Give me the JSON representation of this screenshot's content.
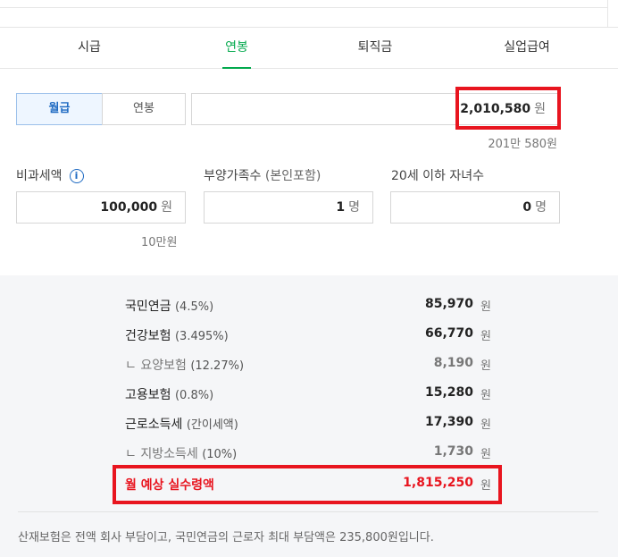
{
  "tabs": [
    {
      "label": "시급"
    },
    {
      "label": "연봉"
    },
    {
      "label": "퇴직금"
    },
    {
      "label": "실업급여"
    }
  ],
  "pay_type": {
    "monthly": "월급",
    "annual": "연봉"
  },
  "salary": {
    "value": "2,010,580",
    "unit": "원",
    "hint": "201만 580원"
  },
  "nontax": {
    "label": "비과세액",
    "value": "100,000",
    "unit": "원",
    "hint": "10만원"
  },
  "dependents": {
    "label": "부양가족수",
    "label_sub": "(본인포함)",
    "value": "1",
    "unit": "명"
  },
  "children": {
    "label": "20세 이하 자녀수",
    "value": "0",
    "unit": "명"
  },
  "results": [
    {
      "name": "국민연금",
      "pct": "(4.5%)",
      "value": "85,970",
      "unit": "원"
    },
    {
      "name": "건강보험",
      "pct": "(3.495%)",
      "value": "66,770",
      "unit": "원"
    },
    {
      "name": "ㄴ 요양보험",
      "pct": "(12.27%)",
      "value": "8,190",
      "unit": "원"
    },
    {
      "name": "고용보험",
      "pct": "(0.8%)",
      "value": "15,280",
      "unit": "원"
    },
    {
      "name": "근로소득세",
      "pct": "(간이세액)",
      "value": "17,390",
      "unit": "원"
    },
    {
      "name": "ㄴ 지방소득세",
      "pct": "(10%)",
      "value": "1,730",
      "unit": "원"
    }
  ],
  "total": {
    "name": "월 예상 실수령액",
    "value": "1,815,250",
    "unit": "원"
  },
  "footnote": "산재보험은 전액 회사 부담이고, 국민연금의 근로자 최대 부담액은 235,800원입니다.",
  "colors": {
    "accent": "#03a94d",
    "highlight": "#e8151f",
    "selected": "#1e6ac2"
  },
  "icons": {
    "info": "info-icon"
  }
}
